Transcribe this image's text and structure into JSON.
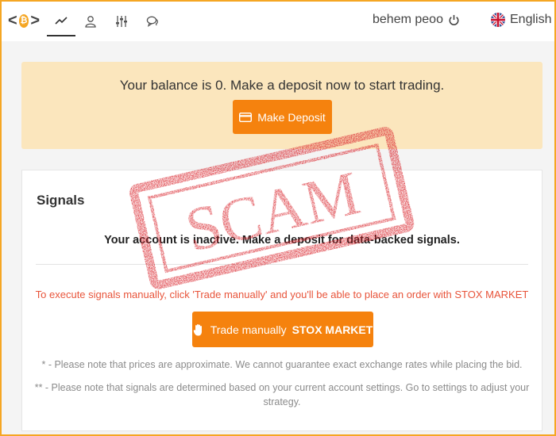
{
  "header": {
    "tabs": [
      {
        "name": "chart",
        "icon": "trend-line-icon",
        "active": true
      },
      {
        "name": "account",
        "icon": "user-icon",
        "active": false
      },
      {
        "name": "settings",
        "icon": "sliders-icon",
        "active": false
      },
      {
        "name": "chat",
        "icon": "chat-bubbles-icon",
        "active": false
      }
    ],
    "username": "behem peoo",
    "language": "English"
  },
  "banner": {
    "text": "Your balance is 0. Make a deposit now to start trading.",
    "deposit_label": "Make Deposit"
  },
  "signals": {
    "title": "Signals",
    "message": "Your account is inactive. Make a deposit for data-backed signals.",
    "warning": "To execute signals manually, click 'Trade manually' and you'll be able to place an order with STOX MARKET",
    "trade_label": "Trade manually",
    "trade_brand": "STOX MARKET",
    "note1": "* - Please note that prices are approximate. We cannot guarantee exact exchange rates while placing the bid.",
    "note2": "** - Please note that signals are determined based on your current account settings. Go to settings to adjust your strategy."
  },
  "stamp": {
    "text": "SCAM"
  },
  "colors": {
    "accent": "#f5820e",
    "banner_bg": "#fbe6bd",
    "warning_text": "#e8543a",
    "stamp_red": "#d9232b"
  }
}
